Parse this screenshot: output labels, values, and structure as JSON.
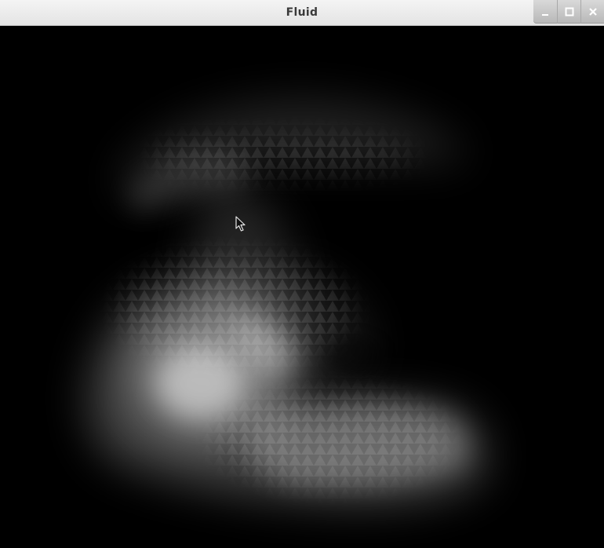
{
  "window": {
    "title": "Fluid"
  },
  "controls": {
    "minimize_icon": "minimize-icon",
    "maximize_icon": "maximize-icon",
    "close_icon": "close-icon"
  },
  "scene": {
    "description_colors": {
      "background": "#000000",
      "smoke": "#ffffff"
    }
  },
  "pointer": {
    "icon": "mouse-pointer-icon"
  }
}
